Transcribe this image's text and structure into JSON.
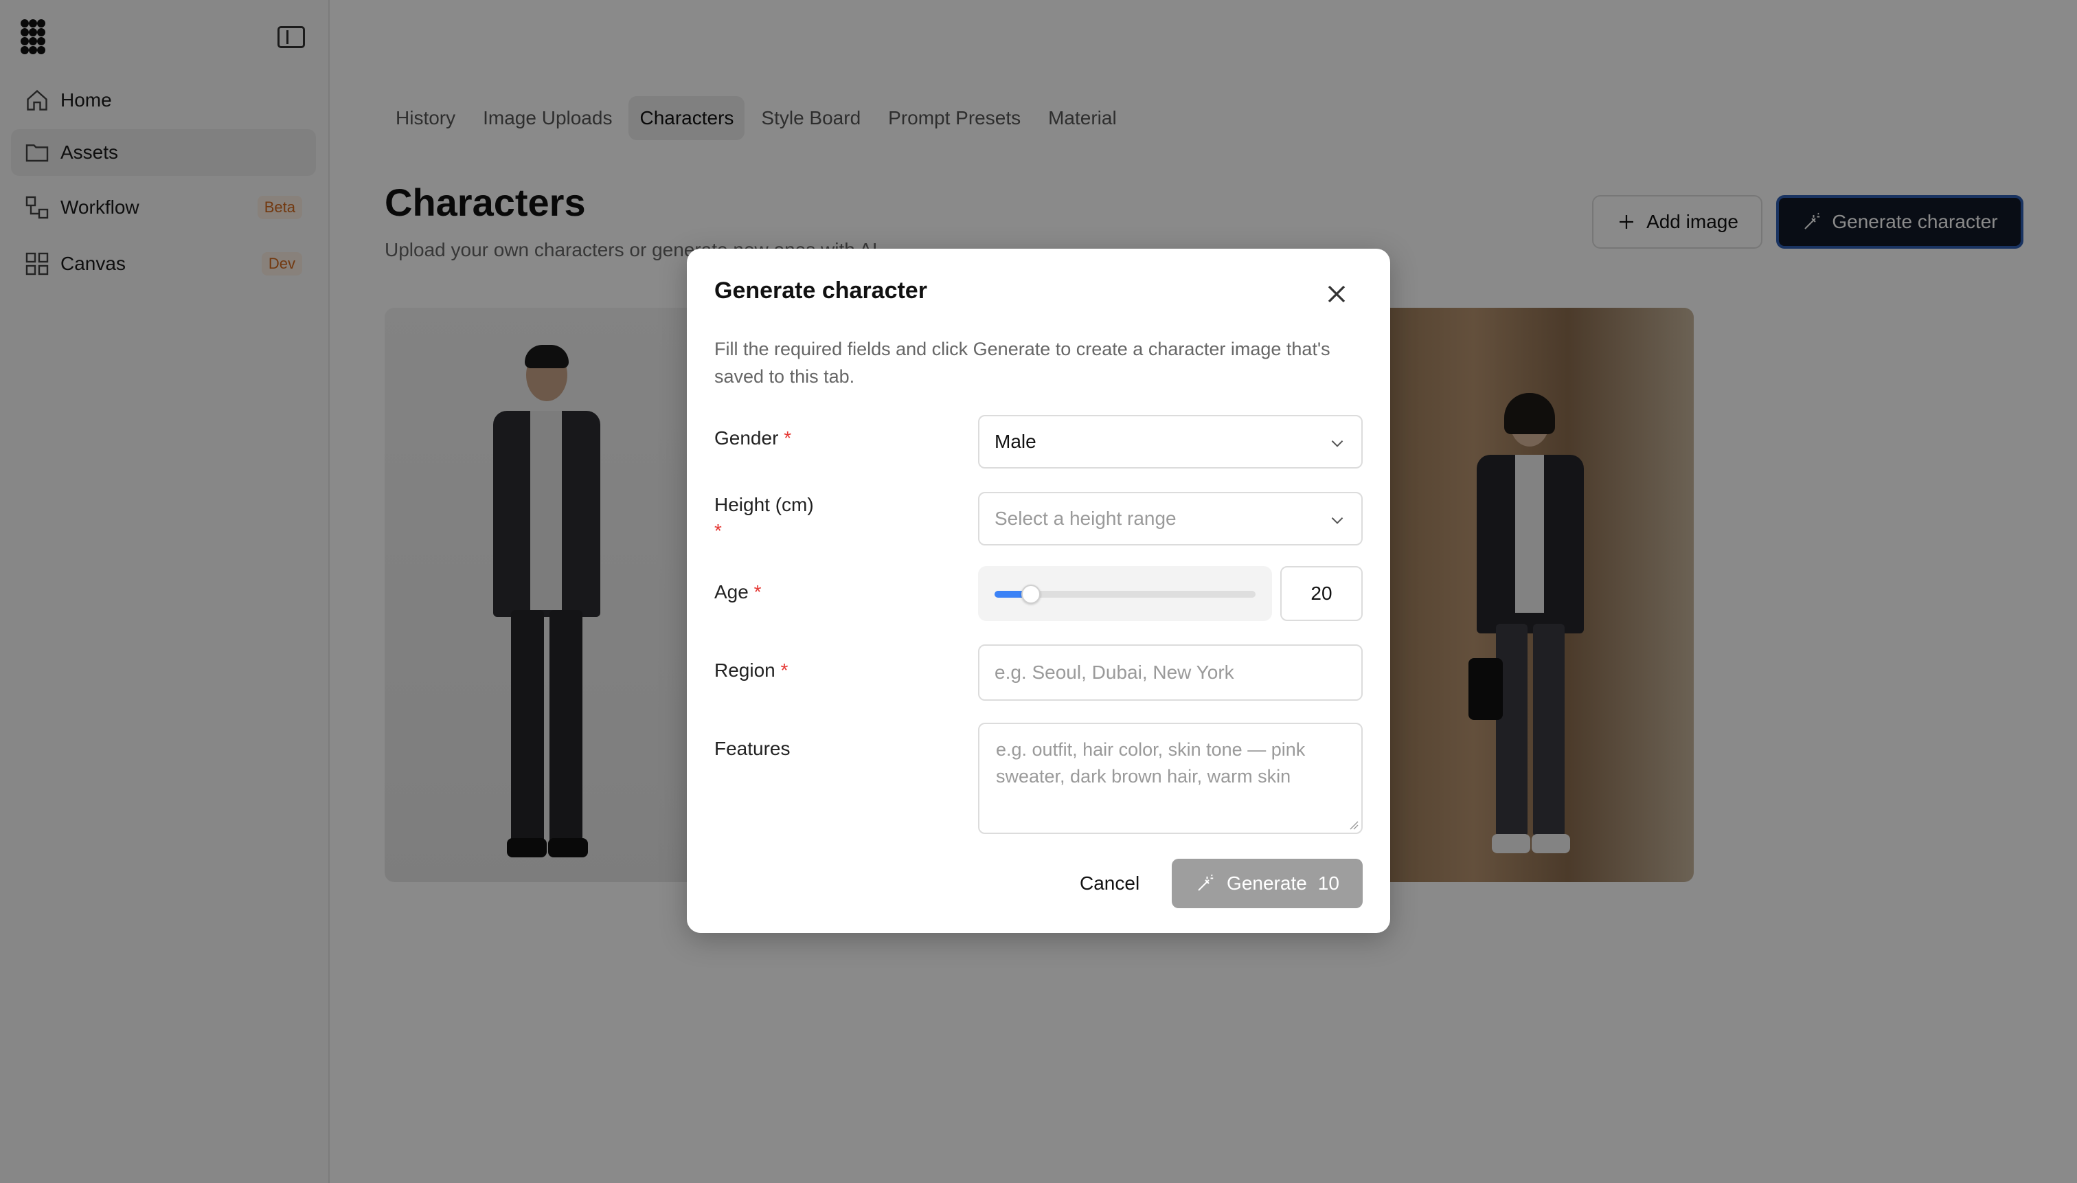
{
  "sidebar": {
    "items": [
      {
        "label": "Home",
        "icon": "home-icon"
      },
      {
        "label": "Assets",
        "icon": "folder-icon"
      },
      {
        "label": "Workflow",
        "icon": "workflow-icon",
        "badge": "Beta"
      },
      {
        "label": "Canvas",
        "icon": "grid-icon",
        "badge": "Dev"
      }
    ]
  },
  "tabs": [
    "History",
    "Image Uploads",
    "Characters",
    "Style Board",
    "Prompt Presets",
    "Material"
  ],
  "active_tab": "Characters",
  "page": {
    "title": "Characters",
    "subtitle": "Upload your own characters or generate new ones with AI",
    "add_image_label": "Add image",
    "generate_character_label": "Generate character"
  },
  "modal": {
    "title": "Generate character",
    "description": "Fill the required fields and click Generate to create a character image that's saved to this tab.",
    "fields": {
      "gender": {
        "label": "Gender",
        "required_mark": "*",
        "value": "Male"
      },
      "height": {
        "label": "Height (cm)",
        "required_mark": "*",
        "placeholder": "Select a height range"
      },
      "age": {
        "label": "Age",
        "required_mark": "*",
        "value": "20",
        "slider_fraction": 0.14
      },
      "region": {
        "label": "Region",
        "required_mark": "*",
        "placeholder": "e.g. Seoul, Dubai, New York"
      },
      "features": {
        "label": "Features",
        "placeholder": "e.g. outfit, hair color, skin tone — pink sweater, dark brown hair, warm skin"
      }
    },
    "cancel_label": "Cancel",
    "generate_label": "Generate",
    "generate_cost": "10"
  },
  "colors": {
    "accent": "#3b82f6",
    "required": "#e53935",
    "badge_text": "#d2691e",
    "primary_button": "#111827"
  }
}
